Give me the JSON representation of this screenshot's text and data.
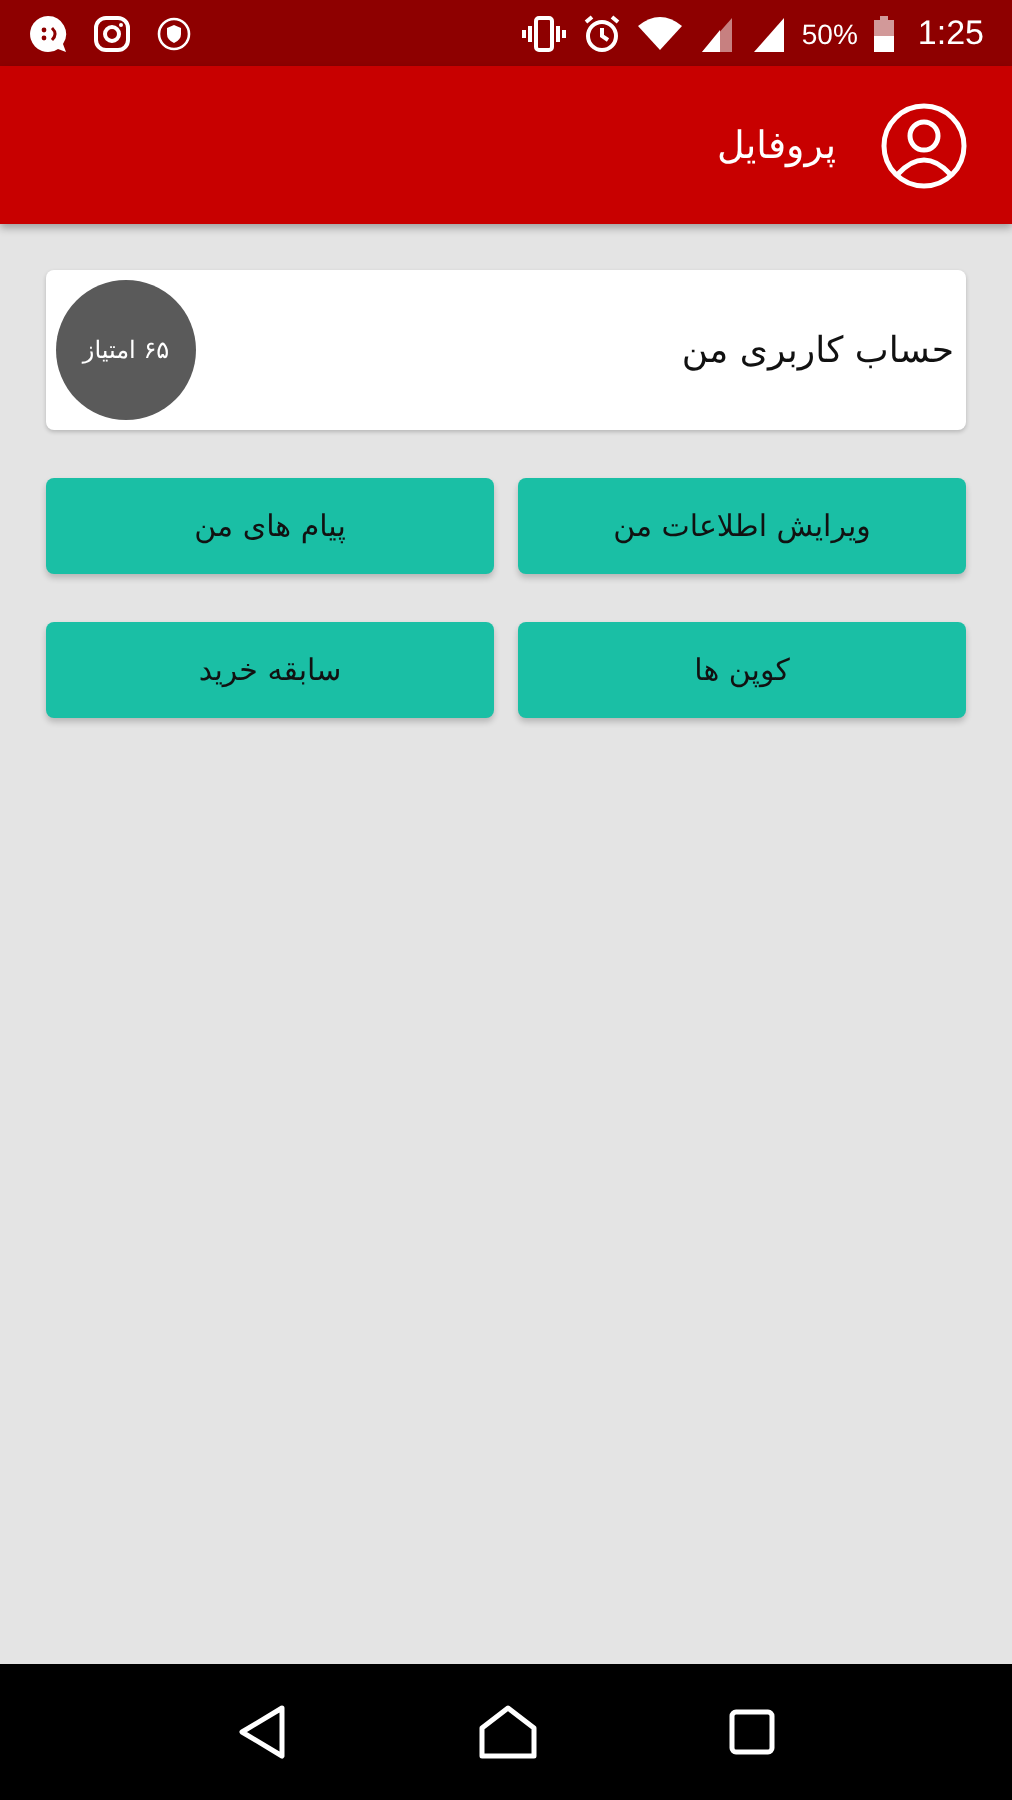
{
  "status_bar": {
    "battery_percent": "50%",
    "time": "1:25"
  },
  "header": {
    "title": "پروفایل"
  },
  "account_card": {
    "title": "حساب کاربری من",
    "points": "۶۵ امتیاز"
  },
  "actions": [
    {
      "label": "ویرایش اطلاعات من"
    },
    {
      "label": "پیام های من"
    },
    {
      "label": "کوپن ها"
    },
    {
      "label": "سابقه خرید"
    }
  ]
}
